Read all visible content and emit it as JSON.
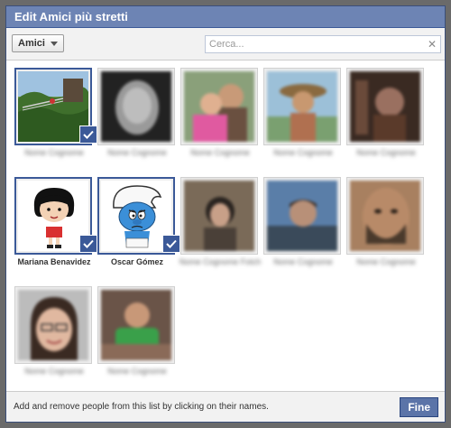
{
  "dialog": {
    "title": "Edit Amici più stretti"
  },
  "toolbar": {
    "filter_label": "Amici",
    "search_placeholder": "Cerca...",
    "clear_icon": "close-icon"
  },
  "people": [
    {
      "name": "Nome Cognome",
      "selected": true,
      "blurred": true,
      "photo": "jungle-bridge"
    },
    {
      "name": "Nome Cognome",
      "selected": false,
      "blurred": true,
      "photo": "grey-portrait"
    },
    {
      "name": "Nome Cognome",
      "selected": false,
      "blurred": true,
      "photo": "couple"
    },
    {
      "name": "Nome Cognome",
      "selected": false,
      "blurred": true,
      "photo": "hat-outdoor"
    },
    {
      "name": "Nome Cognome",
      "selected": false,
      "blurred": true,
      "photo": "dark-sepia"
    },
    {
      "name": "Mariana Benavidez",
      "selected": true,
      "blurred": false,
      "photo": "mafalda"
    },
    {
      "name": "Oscar Gómez",
      "selected": true,
      "blurred": false,
      "photo": "smurf"
    },
    {
      "name": "Nome Cognome Fotch",
      "selected": false,
      "blurred": true,
      "photo": "dark-hair"
    },
    {
      "name": "Nome Cognome",
      "selected": false,
      "blurred": true,
      "photo": "face-blue"
    },
    {
      "name": "Nome Cognome",
      "selected": false,
      "blurred": true,
      "photo": "beard-face"
    },
    {
      "name": "Nome Cognome",
      "selected": false,
      "blurred": true,
      "photo": "glasses-woman"
    },
    {
      "name": "Nome Cognome",
      "selected": false,
      "blurred": true,
      "photo": "green-shirt"
    }
  ],
  "footer": {
    "instructions": "Add and remove people from this list by clicking on their names.",
    "done_label": "Fine"
  },
  "colors": {
    "titlebar": "#6d84b4",
    "accent": "#3b5998",
    "button": "#5b74a8"
  }
}
